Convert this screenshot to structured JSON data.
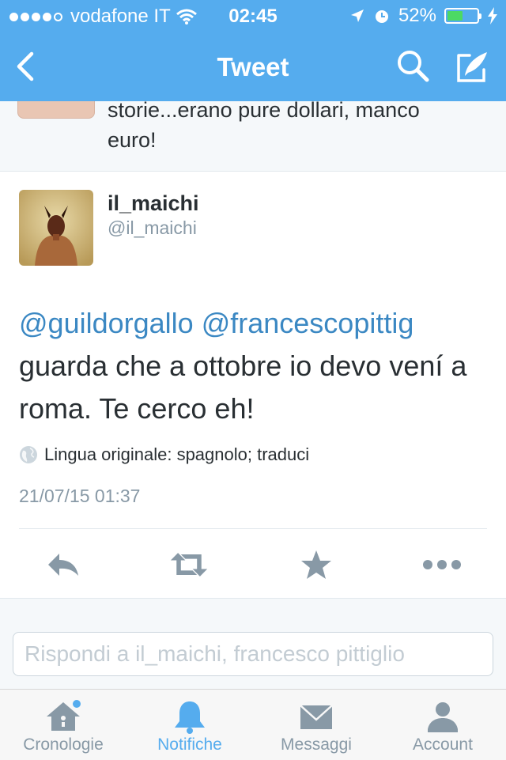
{
  "status_bar": {
    "carrier": "vodafone IT",
    "time": "02:45",
    "battery_percent": "52%",
    "battery_level": 0.52
  },
  "navbar": {
    "title": "Tweet"
  },
  "previous_tweet": {
    "text_line1": "storie...erano pure dollari, manco",
    "text_line2": "euro!"
  },
  "tweet": {
    "name": "il_maichi",
    "handle": "@il_maichi",
    "mention1": "@guildorgallo",
    "mention2": "@francescopittig",
    "body": "guarda che a ottobre io devo vení a roma. Te cerco eh!",
    "language_note": "Lingua originale: spagnolo; traduci",
    "timestamp": "21/07/15 01:37"
  },
  "reply": {
    "placeholder": "Rispondi a il_maichi, francesco pittiglio"
  },
  "tabs": [
    {
      "label": "Cronologie",
      "icon": "home-icon"
    },
    {
      "label": "Notifiche",
      "icon": "bell-icon"
    },
    {
      "label": "Messaggi",
      "icon": "envelope-icon"
    },
    {
      "label": "Account",
      "icon": "person-icon"
    }
  ],
  "colors": {
    "brand": "#55acee",
    "link": "#3b88c3",
    "text": "#292f33",
    "muted": "#8899a6"
  }
}
